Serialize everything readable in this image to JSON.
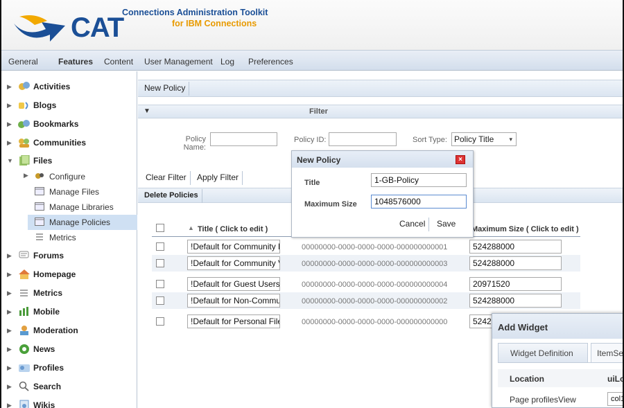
{
  "app": {
    "logo_text": "CAT",
    "title": "Connections Administration Toolkit",
    "subtitle": "for IBM Connections"
  },
  "menu": [
    "General",
    "Features",
    "Content",
    "User Management",
    "Log",
    "Preferences"
  ],
  "sidebar": {
    "items": [
      {
        "label": "Activities",
        "icon": "activities-icon"
      },
      {
        "label": "Blogs",
        "icon": "blogs-icon"
      },
      {
        "label": "Bookmarks",
        "icon": "bookmarks-icon"
      },
      {
        "label": "Communities",
        "icon": "communities-icon"
      },
      {
        "label": "Files",
        "icon": "files-icon"
      },
      {
        "label": "Forums",
        "icon": "forums-icon"
      },
      {
        "label": "Homepage",
        "icon": "homepage-icon"
      },
      {
        "label": "Metrics",
        "icon": "metrics-icon"
      },
      {
        "label": "Mobile",
        "icon": "mobile-icon"
      },
      {
        "label": "Moderation",
        "icon": "moderation-icon"
      },
      {
        "label": "News",
        "icon": "news-icon"
      },
      {
        "label": "Profiles",
        "icon": "profiles-icon"
      },
      {
        "label": "Search",
        "icon": "search-icon"
      },
      {
        "label": "Wikis",
        "icon": "wikis-icon"
      }
    ],
    "files_sub": [
      {
        "label": "Configure",
        "icon": "configure-icon"
      },
      {
        "label": "Manage Files",
        "icon": "manage-files-icon"
      },
      {
        "label": "Manage Libraries",
        "icon": "manage-libraries-icon"
      },
      {
        "label": "Manage Policies",
        "icon": "manage-policies-icon"
      },
      {
        "label": "Metrics",
        "icon": "metrics-icon"
      }
    ]
  },
  "toolbar": {
    "new_policy": "New Policy"
  },
  "filter": {
    "title": "Filter",
    "policy_name_label": "Policy Name:",
    "policy_name_value": "",
    "policy_id_label": "Policy ID:",
    "policy_id_value": "",
    "sort_type_label": "Sort Type:",
    "sort_type_value": "Policy Title",
    "clear": "Clear Filter",
    "apply": "Apply Filter"
  },
  "delete_policies": "Delete Policies",
  "table": {
    "col_title": "Title ( Click to edit )",
    "col_size": "Maximum Size ( Click to edit )",
    "rows": [
      {
        "title": "!Default for Community F",
        "id": "00000000-0000-0000-0000-000000000001",
        "size": "524288000"
      },
      {
        "title": "!Default for Community V",
        "id": "00000000-0000-0000-0000-000000000003",
        "size": "524288000"
      },
      {
        "title": "!Default for Guest Users",
        "id": "00000000-0000-0000-0000-000000000004",
        "size": "20971520"
      },
      {
        "title": "!Default for Non-Commu",
        "id": "00000000-0000-0000-0000-000000000002",
        "size": "524288000"
      },
      {
        "title": "!Default for Personal File",
        "id": "00000000-0000-0000-0000-000000000000",
        "size": "5242"
      }
    ]
  },
  "dialog": {
    "title": "New Policy",
    "title_label": "Title",
    "title_value": "1-GB-Policy",
    "max_label": "Maximum Size",
    "max_value": "1048576000",
    "cancel": "Cancel",
    "save": "Save"
  },
  "widget": {
    "title": "Add Widget",
    "tabs": [
      "Widget Definition",
      "ItemSe"
    ],
    "col_location": "Location",
    "col_other": "uiLo",
    "row_location": "Page profilesView",
    "row_value": "col1"
  }
}
